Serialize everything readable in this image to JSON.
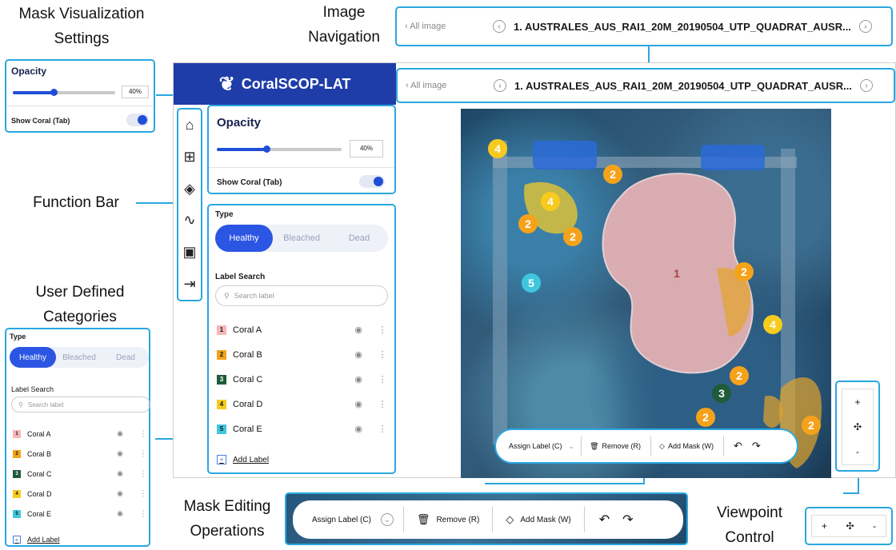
{
  "callouts": {
    "mask_visualization": [
      "Mask Visualization",
      "Settings"
    ],
    "image_navigation": [
      "Image",
      "Navigation"
    ],
    "function_bar": "Function Bar",
    "user_defined_categories": [
      "User Defined",
      "Categories"
    ],
    "mask_editing_operations": [
      "Mask Editing",
      "Operations"
    ],
    "viewpoint_control": [
      "Viewpoint",
      "Control"
    ]
  },
  "app": {
    "name": "CoralSCOP-LAT",
    "logo_icon": "coral-icon"
  },
  "navigation": {
    "back_label": "All image",
    "file_name": "1. AUSTRALES_AUS_RAI1_20M_20190504_UTP_QUADRAT_AUSR..."
  },
  "function_bar": {
    "items": [
      {
        "icon": "home-icon",
        "glyph": "⌂"
      },
      {
        "icon": "grid-icon",
        "glyph": "⊞"
      },
      {
        "icon": "layers-icon",
        "glyph": "◈"
      },
      {
        "icon": "activity-icon",
        "glyph": "∿"
      },
      {
        "icon": "save-icon",
        "glyph": "▣"
      },
      {
        "icon": "exit-icon",
        "glyph": "⇥"
      }
    ]
  },
  "visualization": {
    "title": "Opacity",
    "opacity_value": "40%",
    "opacity_fraction": 0.4,
    "show_coral_label": "Show Coral (Tab)",
    "show_coral_on": true
  },
  "categories": {
    "type_label": "Type",
    "types": [
      "Healthy",
      "Bleached",
      "Dead"
    ],
    "active_type": "Healthy",
    "search_title": "Label Search",
    "search_placeholder": "Search label",
    "labels": [
      {
        "num": "1",
        "name": "Coral A",
        "color": "#f7b7b7"
      },
      {
        "num": "2",
        "name": "Coral B",
        "color": "#f5a21b"
      },
      {
        "num": "3",
        "name": "Coral C",
        "color": "#1f5b3a"
      },
      {
        "num": "4",
        "name": "Coral D",
        "color": "#f6cb1e"
      },
      {
        "num": "5",
        "name": "Coral E",
        "color": "#3fc6de"
      }
    ],
    "add_label": "Add Label"
  },
  "editing": {
    "assign_label": "Assign Label (C)",
    "remove_label": "Remove (R)",
    "add_mask_label": "Add Mask (W)",
    "undo_icon": "undo-icon",
    "redo_icon": "redo-icon"
  },
  "viewpoint": {
    "zoom_in": "+",
    "pan": "✣",
    "zoom_out": "-"
  },
  "image_markers": [
    {
      "num": "4",
      "color": "#f6cb1e"
    },
    {
      "num": "2",
      "color": "#f5a21b"
    },
    {
      "num": "4",
      "color": "#f6cb1e"
    },
    {
      "num": "2",
      "color": "#f5a21b"
    },
    {
      "num": "2",
      "color": "#f5a21b"
    },
    {
      "num": "1",
      "color": "#f7b7b7"
    },
    {
      "num": "2",
      "color": "#f5a21b"
    },
    {
      "num": "5",
      "color": "#3fc6de"
    },
    {
      "num": "4",
      "color": "#f6cb1e"
    },
    {
      "num": "2",
      "color": "#f5a21b"
    },
    {
      "num": "3",
      "color": "#1f5b3a"
    },
    {
      "num": "2",
      "color": "#f5a21b"
    },
    {
      "num": "2",
      "color": "#f5a21b"
    }
  ],
  "colors": {
    "accent": "#2b55e3",
    "callout_border": "#2aa7e0",
    "header": "#1f3da8"
  }
}
